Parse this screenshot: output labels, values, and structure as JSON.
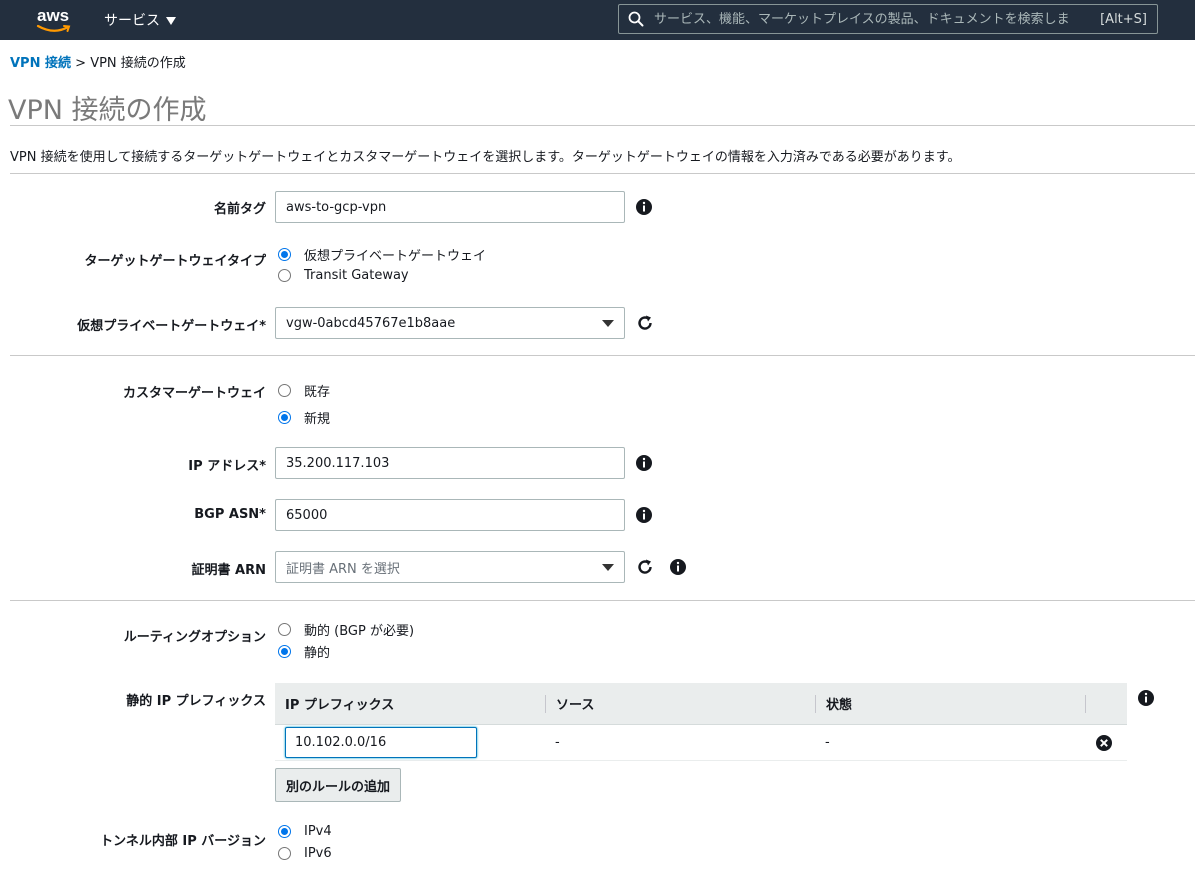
{
  "nav": {
    "logo_text": "aws",
    "services_label": "サービス",
    "search_placeholder": "サービス、機能、マーケットプレイスの製品、ドキュメントを検索しま",
    "search_shortcut": "[Alt+S]"
  },
  "breadcrumb": {
    "link": "VPN 接続",
    "separator": ">",
    "current": "VPN 接続の作成"
  },
  "page": {
    "title": "VPN 接続の作成",
    "description": "VPN 接続を使用して接続するターゲットゲートウェイとカスタマーゲートウェイを選択します。ターゲットゲートウェイの情報を入力済みである必要があります。"
  },
  "form": {
    "name_tag": {
      "label": "名前タグ",
      "value": "aws-to-gcp-vpn"
    },
    "target_gateway_type": {
      "label": "ターゲットゲートウェイタイプ",
      "options": [
        "仮想プライベートゲートウェイ",
        "Transit Gateway"
      ],
      "selected": 0
    },
    "virtual_private_gateway": {
      "label": "仮想プライベートゲートウェイ*",
      "value": "vgw-0abcd45767e1b8aae"
    },
    "customer_gateway": {
      "label": "カスタマーゲートウェイ",
      "options": [
        "既存",
        "新規"
      ],
      "selected": 1
    },
    "ip_address": {
      "label": "IP アドレス*",
      "value": "35.200.117.103"
    },
    "bgp_asn": {
      "label": "BGP ASN*",
      "value": "65000"
    },
    "certificate_arn": {
      "label": "証明書 ARN",
      "placeholder": "証明書 ARN を選択"
    },
    "routing_options": {
      "label": "ルーティングオプション",
      "options": [
        "動的 (BGP が必要)",
        "静的"
      ],
      "selected": 1
    },
    "static_ip_prefixes": {
      "label": "静的 IP プレフィックス",
      "columns": [
        "IP プレフィックス",
        "ソース",
        "状態"
      ],
      "rows": [
        {
          "prefix": "10.102.0.0/16",
          "source": "-",
          "status": "-"
        }
      ],
      "add_rule_label": "別のルールの追加"
    },
    "tunnel_ip_version": {
      "label": "トンネル内部 IP バージョン",
      "options": [
        "IPv4",
        "IPv6"
      ],
      "selected": 0
    }
  },
  "colors": {
    "nav_bg": "#232f3e",
    "link": "#0073bb",
    "radio_checked": "#0075eb",
    "aws_orange": "#ff9900"
  }
}
